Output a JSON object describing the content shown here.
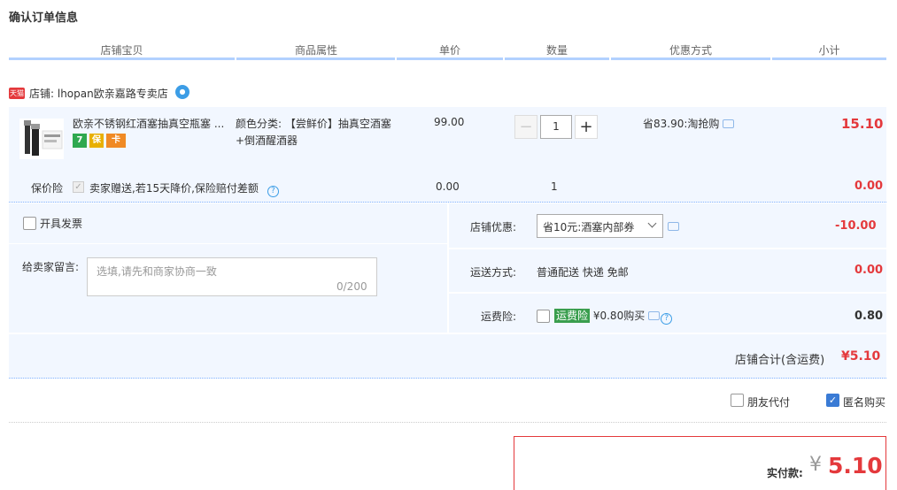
{
  "page": {
    "title": "确认订单信息"
  },
  "columns": [
    "店铺宝贝",
    "商品属性",
    "单价",
    "数量",
    "优惠方式",
    "小计"
  ],
  "shop": {
    "tag": "天猫",
    "label": "店铺: lhopan欧亲嘉路专卖店"
  },
  "item": {
    "name": "欧亲不锈钢红酒塞抽真空瓶塞 ...",
    "badges": [
      "7",
      "保",
      "卡"
    ],
    "attr": "颜色分类: 【尝鲜价】抽真空酒塞+倒酒醒酒器",
    "price": "99.00",
    "qty": "1",
    "qty_minus": "−",
    "qty_plus": "+",
    "discount": "省83.90:淘抢购",
    "subtotal": "15.10"
  },
  "insurance": {
    "label": "保价险",
    "check": "✓",
    "text": "卖家赠送,若15天降价,保险赔付差额",
    "help": "?",
    "price": "0.00",
    "qty": "1",
    "subtotal": "0.00"
  },
  "invoice": {
    "label": "开具发票"
  },
  "message": {
    "label": "给卖家留言:",
    "placeholder": "选填,请先和商家协商一致",
    "counter": "0/200"
  },
  "shop_discount": {
    "label": "店铺优惠:",
    "selected": "省10元:酒塞内部券",
    "amount": "-10.00"
  },
  "shipping": {
    "label": "运送方式:",
    "value": "普通配送 快递 免邮",
    "amount": "0.00"
  },
  "shipping_insurance": {
    "label": "运费险:",
    "tag": "运费险",
    "text": "¥0.80购买",
    "help": "?",
    "amount": "0.80"
  },
  "shop_total": {
    "label": "店铺合计(含运费)",
    "amount": "¥5.10"
  },
  "options": {
    "friend_pay": "朋友代付",
    "anonymous": "匿名购买",
    "check": "✓"
  },
  "payment": {
    "label": "实付款:",
    "currency": "¥",
    "amount": "5.10"
  },
  "colors": {
    "accent_red": "#e4393c",
    "header_line": "#b2d1ff",
    "row_bg": "#f2f7ff",
    "check_blue": "#3a7bd5"
  }
}
